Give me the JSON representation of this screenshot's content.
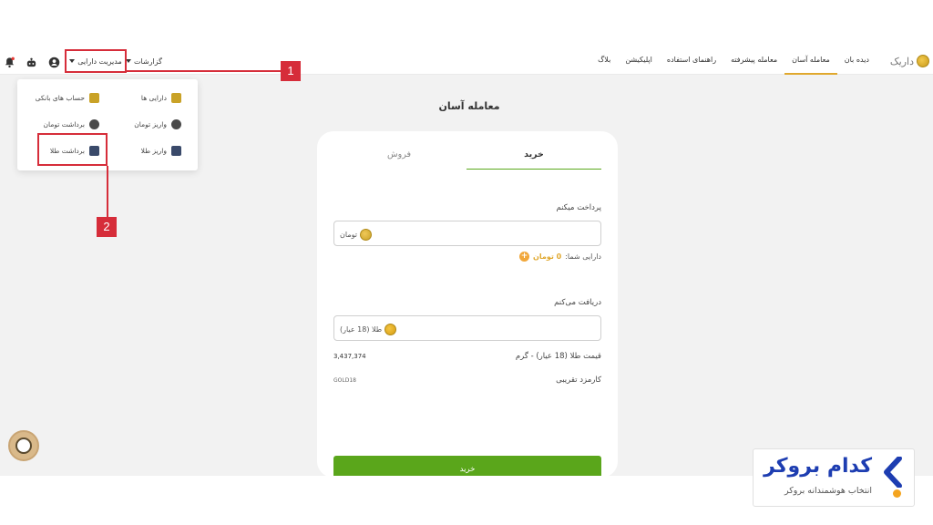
{
  "navbar": {
    "logo_text": "داریک",
    "links": [
      "دیده بان",
      "معامله آسان",
      "معامله پیشرفته",
      "راهنمای استفاده",
      "اپلیکیشن",
      "بلاگ"
    ],
    "active_index": 1,
    "menu_label": "مدیریت دارایی",
    "reports_label": "گزارشات"
  },
  "dropdown": {
    "items": [
      {
        "label": "دارایی ها",
        "icon": "wallet-icon",
        "color": "#c9a227"
      },
      {
        "label": "حساب های بانکی",
        "icon": "bank-card-icon",
        "color": "#c9a227"
      },
      {
        "label": "واریز تومان",
        "icon": "deposit-toman-icon",
        "color": "#4a4a4a"
      },
      {
        "label": "برداشت تومان",
        "icon": "withdraw-toman-icon",
        "color": "#4a4a4a"
      },
      {
        "label": "واریز طلا",
        "icon": "deposit-gold-icon",
        "color": "#3a4a6a"
      },
      {
        "label": "برداشت طلا",
        "icon": "withdraw-gold-icon",
        "color": "#3a4a6a"
      }
    ]
  },
  "callouts": [
    "1",
    "2"
  ],
  "page": {
    "title": "معامله آسان"
  },
  "trade": {
    "tabs": {
      "buy": "خرید",
      "sell": "فروش"
    },
    "pay_label": "پرداخت میکنم",
    "pay_currency": "تومان",
    "balance_label": "دارایی شما:",
    "balance_value": "0 تومان",
    "receive_label": "دریافت می‌کنم",
    "receive_currency": "طلا (18 عیار)",
    "price_label": "قیمت طلا (18 عیار) - گرم",
    "price_value": "3,437,374",
    "fee_label": "کارمزد تقریبی",
    "fee_value": "GOLD18",
    "submit_label": "خرید"
  },
  "brand": {
    "title": "کدام بروکر",
    "subtitle": "انتخاب هوشمندانه بروکر"
  },
  "colors": {
    "accent_green": "#5aa61b",
    "accent_gold": "#e0a82e",
    "callout_red": "#d62d3a",
    "brand_blue": "#1d3db1"
  }
}
